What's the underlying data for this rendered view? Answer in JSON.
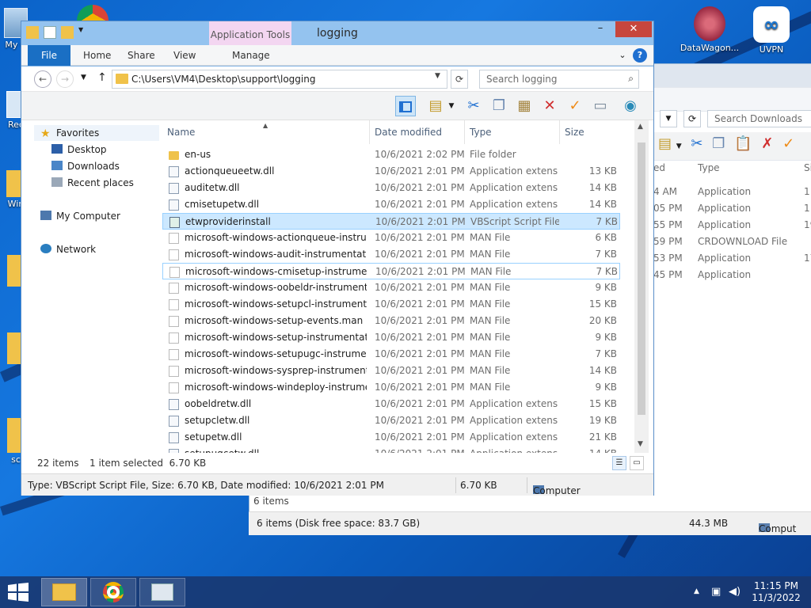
{
  "desktop": {
    "icons": [
      {
        "label": "My C"
      },
      {
        "label": "Rec"
      },
      {
        "label": "Win"
      },
      {
        "label": "sc"
      },
      {
        "label": "DataWagon..."
      },
      {
        "label": "UVPN"
      }
    ]
  },
  "back_window": {
    "search_placeholder": "Search Downloads",
    "col_type": "Type",
    "col_size": "Size",
    "col_date_fragment": "ed",
    "rows": [
      {
        "date": "4 AM",
        "type": "Application",
        "size": "1"
      },
      {
        "date": "05 PM",
        "type": "Application",
        "size": "1"
      },
      {
        "date": "55 PM",
        "type": "Application",
        "size": "19"
      },
      {
        "date": "59 PM",
        "type": "CRDOWNLOAD File",
        "size": ""
      },
      {
        "date": "53 PM",
        "type": "Application",
        "size": "17"
      },
      {
        "date": "45 PM",
        "type": "Application",
        "size": ""
      }
    ],
    "status_items": "6 items",
    "status_bar": "6 items (Disk free space: 83.7 GB)",
    "status_size": "44.3 MB",
    "status_computer": "Comput"
  },
  "window": {
    "title": "logging",
    "contextual_tab": "Application Tools",
    "tabs": {
      "file": "File",
      "home": "Home",
      "share": "Share",
      "view": "View",
      "manage": "Manage"
    },
    "controls": {
      "minimize": "–",
      "maximize": "☐",
      "close": "✕"
    },
    "address": "C:\\Users\\VM4\\Desktop\\support\\logging",
    "search_placeholder": "Search logging"
  },
  "nav_pane": {
    "favorites": "Favorites",
    "desktop": "Desktop",
    "downloads": "Downloads",
    "recent": "Recent places",
    "computer": "My Computer",
    "network": "Network"
  },
  "columns": {
    "name": "Name",
    "date": "Date modified",
    "type": "Type",
    "size": "Size"
  },
  "files": [
    {
      "name": "en-us",
      "date": "10/6/2021 2:02 PM",
      "type": "File folder",
      "size": "",
      "icon": "folder"
    },
    {
      "name": "actionqueueetw.dll",
      "date": "10/6/2021 2:01 PM",
      "type": "Application extens...",
      "size": "13 KB",
      "icon": "dll"
    },
    {
      "name": "auditetw.dll",
      "date": "10/6/2021 2:01 PM",
      "type": "Application extens...",
      "size": "14 KB",
      "icon": "dll"
    },
    {
      "name": "cmisetupetw.dll",
      "date": "10/6/2021 2:01 PM",
      "type": "Application extens...",
      "size": "14 KB",
      "icon": "dll"
    },
    {
      "name": "etwproviderinstall",
      "date": "10/6/2021 2:01 PM",
      "type": "VBScript Script File",
      "size": "7 KB",
      "icon": "vbs"
    },
    {
      "name": "microsoft-windows-actionqueue-instru...",
      "date": "10/6/2021 2:01 PM",
      "type": "MAN File",
      "size": "6 KB",
      "icon": "man"
    },
    {
      "name": "microsoft-windows-audit-instrumentati...",
      "date": "10/6/2021 2:01 PM",
      "type": "MAN File",
      "size": "7 KB",
      "icon": "man"
    },
    {
      "name": "microsoft-windows-cmisetup-instrumen...",
      "date": "10/6/2021 2:01 PM",
      "type": "MAN File",
      "size": "7 KB",
      "icon": "man"
    },
    {
      "name": "microsoft-windows-oobeldr-instrument...",
      "date": "10/6/2021 2:01 PM",
      "type": "MAN File",
      "size": "9 KB",
      "icon": "man"
    },
    {
      "name": "microsoft-windows-setupcl-instrumenta...",
      "date": "10/6/2021 2:01 PM",
      "type": "MAN File",
      "size": "15 KB",
      "icon": "man"
    },
    {
      "name": "microsoft-windows-setup-events.man",
      "date": "10/6/2021 2:01 PM",
      "type": "MAN File",
      "size": "20 KB",
      "icon": "man"
    },
    {
      "name": "microsoft-windows-setup-instrumentati...",
      "date": "10/6/2021 2:01 PM",
      "type": "MAN File",
      "size": "9 KB",
      "icon": "man"
    },
    {
      "name": "microsoft-windows-setupugc-instrumen...",
      "date": "10/6/2021 2:01 PM",
      "type": "MAN File",
      "size": "7 KB",
      "icon": "man"
    },
    {
      "name": "microsoft-windows-sysprep-instrumenta...",
      "date": "10/6/2021 2:01 PM",
      "type": "MAN File",
      "size": "14 KB",
      "icon": "man"
    },
    {
      "name": "microsoft-windows-windeploy-instrume...",
      "date": "10/6/2021 2:01 PM",
      "type": "MAN File",
      "size": "9 KB",
      "icon": "man"
    },
    {
      "name": "oobeldretw.dll",
      "date": "10/6/2021 2:01 PM",
      "type": "Application extens...",
      "size": "15 KB",
      "icon": "dll"
    },
    {
      "name": "setupcletw.dll",
      "date": "10/6/2021 2:01 PM",
      "type": "Application extens...",
      "size": "19 KB",
      "icon": "dll"
    },
    {
      "name": "setupetw.dll",
      "date": "10/6/2021 2:01 PM",
      "type": "Application extens...",
      "size": "21 KB",
      "icon": "dll"
    },
    {
      "name": "setupugcetw.dll",
      "date": "10/6/2021 2:01 PM",
      "type": "Application extens...",
      "size": "14 KB",
      "icon": "dll"
    }
  ],
  "selected_index": 4,
  "focused_index": 7,
  "status": {
    "items": "22 items",
    "selected": "1 item selected  6.70 KB",
    "details": "Type: VBScript Script File, Size: 6.70 KB, Date modified: 10/6/2021 2:01 PM",
    "size": "6.70 KB",
    "computer": "Computer"
  },
  "clock": {
    "time": "11:15 PM",
    "date": "11/3/2022"
  },
  "colors": {
    "accent": "#1a6fc4",
    "selection": "#cce8ff",
    "close": "#c7463d",
    "contextual": "#f3d6f1"
  }
}
